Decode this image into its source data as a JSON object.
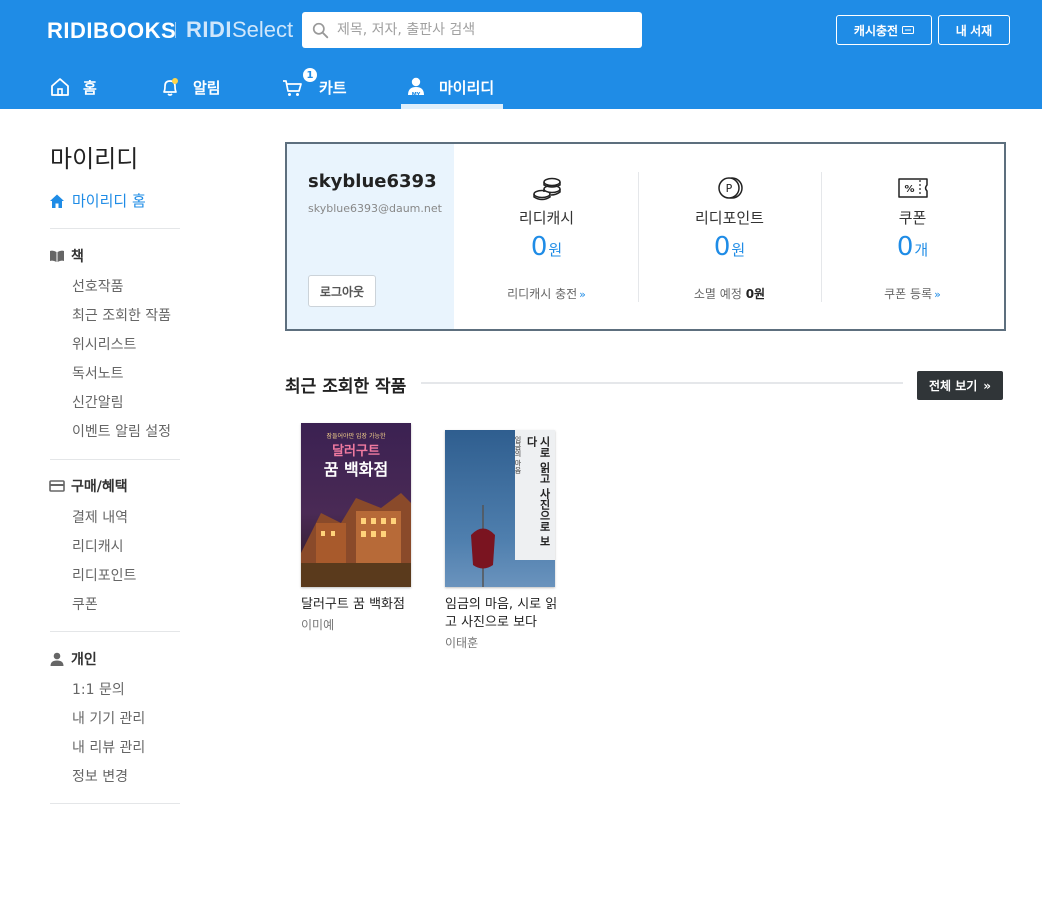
{
  "header": {
    "logo": "RIDIBOOKS",
    "select_brand": "RIDI",
    "select_suffix": "Select",
    "search_placeholder": "제목, 저자, 출판사 검색",
    "charge_button": "캐시충전",
    "library_button": "내 서재",
    "nav": [
      {
        "label": "홈",
        "icon": "home-icon"
      },
      {
        "label": "알림",
        "icon": "bell-icon"
      },
      {
        "label": "카트",
        "icon": "cart-icon",
        "badge": "1"
      },
      {
        "label": "마이리디",
        "icon": "my-user-icon"
      }
    ],
    "brand_color": "#1f8ce6"
  },
  "sidebar": {
    "title": "마이리디",
    "home_link": "마이리디 홈",
    "groups": [
      {
        "label": "책",
        "icon": "book-icon",
        "items": [
          "선호작품",
          "최근 조회한 작품",
          "위시리스트",
          "독서노트",
          "신간알림",
          "이벤트 알림 설정"
        ]
      },
      {
        "label": "구매/혜택",
        "icon": "card-icon",
        "items": [
          "결제 내역",
          "리디캐시",
          "리디포인트",
          "쿠폰"
        ]
      },
      {
        "label": "개인",
        "icon": "person-icon",
        "items": [
          "1:1 문의",
          "내 기기 관리",
          "내 리뷰 관리",
          "정보 변경"
        ]
      }
    ]
  },
  "account": {
    "user_id": "skyblue6393",
    "email": "skyblue6393@daum.net",
    "logout": "로그아웃",
    "stats": [
      {
        "label": "리디캐시",
        "value": "0",
        "unit": "원",
        "link": "리디캐시 충전",
        "arrow": "»",
        "icon": "coins-icon"
      },
      {
        "label": "리디포인트",
        "value": "0",
        "unit": "원",
        "link_prefix": "소멸 예정",
        "link_value": "0원",
        "icon": "point-icon"
      },
      {
        "label": "쿠폰",
        "value": "0",
        "unit": "개",
        "link": "쿠폰 등록",
        "arrow": "»",
        "icon": "coupon-icon"
      }
    ]
  },
  "recent": {
    "title": "최근 조회한 작품",
    "view_all": "전체 보기",
    "view_all_arrow": "»",
    "books": [
      {
        "title": "달러구트 꿈 백화점",
        "author": "이미예",
        "cover_text_top": "잠들어야만 입장 가능한",
        "cover_text_main": "달러구트",
        "cover_text_sub": "꿈 백화점"
      },
      {
        "title": "임금의 마음, 시로 읽고 사진으로 보다",
        "author": "이태훈",
        "cover_text_main": "시로 읽고 사진으로 보다",
        "cover_text_sub": "임금의 마음"
      }
    ]
  }
}
